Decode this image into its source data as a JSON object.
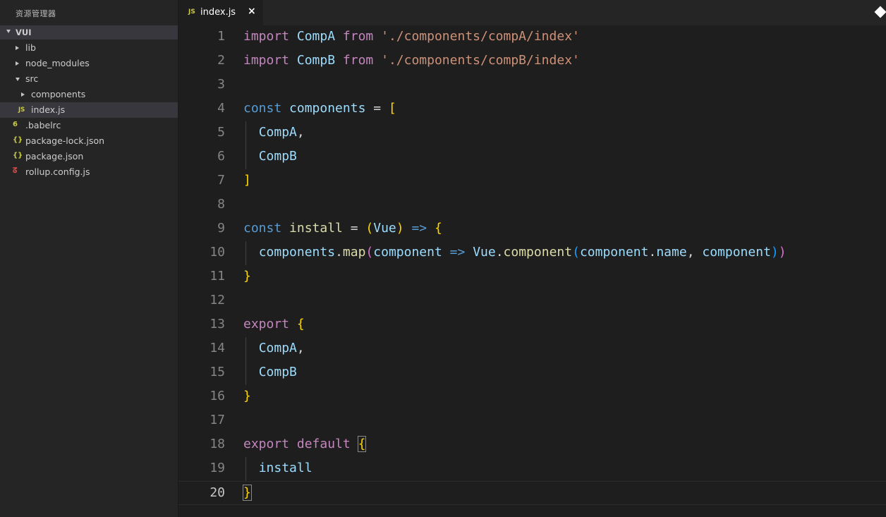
{
  "sidebar": {
    "title": "资源管理器",
    "section": "VUI",
    "items": [
      {
        "label": "lib",
        "type": "folder",
        "expanded": false,
        "depth": 1
      },
      {
        "label": "node_modules",
        "type": "folder",
        "expanded": false,
        "depth": 1
      },
      {
        "label": "src",
        "type": "folder",
        "expanded": true,
        "depth": 1
      },
      {
        "label": "components",
        "type": "folder",
        "expanded": false,
        "depth": 2
      },
      {
        "label": "index.js",
        "type": "js",
        "depth": 2,
        "selected": true
      },
      {
        "label": ".babelrc",
        "type": "babel",
        "depth": 1
      },
      {
        "label": "package-lock.json",
        "type": "json",
        "depth": 1
      },
      {
        "label": "package.json",
        "type": "json",
        "depth": 1
      },
      {
        "label": "rollup.config.js",
        "type": "rollup",
        "depth": 1
      }
    ]
  },
  "icons": {
    "js": "JS",
    "json": "{}",
    "babel": "6",
    "rollup": "ᘔ"
  },
  "tabs": [
    {
      "label": "index.js",
      "icon": "JS",
      "close": "×"
    }
  ],
  "editor": {
    "active_line": 20,
    "lines": [
      {
        "n": "1",
        "tokens": [
          [
            "import",
            "tk-keyword"
          ],
          [
            " ",
            "tk-plain"
          ],
          [
            "CompA",
            "tk-var"
          ],
          [
            " ",
            "tk-plain"
          ],
          [
            "from",
            "tk-keyword"
          ],
          [
            " ",
            "tk-plain"
          ],
          [
            "'./components/compA/index'",
            "tk-str"
          ]
        ]
      },
      {
        "n": "2",
        "tokens": [
          [
            "import",
            "tk-keyword"
          ],
          [
            " ",
            "tk-plain"
          ],
          [
            "CompB",
            "tk-var"
          ],
          [
            " ",
            "tk-plain"
          ],
          [
            "from",
            "tk-keyword"
          ],
          [
            " ",
            "tk-plain"
          ],
          [
            "'./components/compB/index'",
            "tk-str"
          ]
        ]
      },
      {
        "n": "3",
        "tokens": []
      },
      {
        "n": "4",
        "tokens": [
          [
            "const",
            "tk-kw2"
          ],
          [
            " ",
            "tk-plain"
          ],
          [
            "components",
            "tk-var"
          ],
          [
            " = ",
            "tk-op"
          ],
          [
            "[",
            "tk-brace"
          ]
        ]
      },
      {
        "n": "5",
        "tokens": [
          [
            "  ",
            "tk-plain"
          ],
          [
            "CompA",
            "tk-var"
          ],
          [
            ",",
            "tk-plain"
          ]
        ]
      },
      {
        "n": "6",
        "tokens": [
          [
            "  ",
            "tk-plain"
          ],
          [
            "CompB",
            "tk-var"
          ]
        ]
      },
      {
        "n": "7",
        "tokens": [
          [
            "]",
            "tk-brace"
          ]
        ]
      },
      {
        "n": "8",
        "tokens": []
      },
      {
        "n": "9",
        "tokens": [
          [
            "const",
            "tk-kw2"
          ],
          [
            " ",
            "tk-plain"
          ],
          [
            "install",
            "tk-func"
          ],
          [
            " = ",
            "tk-op"
          ],
          [
            "(",
            "tk-brace"
          ],
          [
            "Vue",
            "tk-var"
          ],
          [
            ")",
            "tk-brace"
          ],
          [
            " ",
            "tk-plain"
          ],
          [
            "=>",
            "tk-kw2"
          ],
          [
            " ",
            "tk-plain"
          ],
          [
            "{",
            "tk-brace"
          ]
        ]
      },
      {
        "n": "10",
        "tokens": [
          [
            "  ",
            "tk-plain"
          ],
          [
            "components",
            "tk-var"
          ],
          [
            ".",
            "tk-plain"
          ],
          [
            "map",
            "tk-func"
          ],
          [
            "(",
            "tk-paren2"
          ],
          [
            "component",
            "tk-var"
          ],
          [
            " ",
            "tk-plain"
          ],
          [
            "=>",
            "tk-kw2"
          ],
          [
            " ",
            "tk-plain"
          ],
          [
            "Vue",
            "tk-var"
          ],
          [
            ".",
            "tk-plain"
          ],
          [
            "component",
            "tk-func"
          ],
          [
            "(",
            "tk-paren3"
          ],
          [
            "component",
            "tk-var"
          ],
          [
            ".",
            "tk-plain"
          ],
          [
            "name",
            "tk-var"
          ],
          [
            ", ",
            "tk-plain"
          ],
          [
            "component",
            "tk-var"
          ],
          [
            ")",
            "tk-paren3"
          ],
          [
            ")",
            "tk-paren2"
          ]
        ]
      },
      {
        "n": "11",
        "tokens": [
          [
            "}",
            "tk-brace"
          ]
        ]
      },
      {
        "n": "12",
        "tokens": []
      },
      {
        "n": "13",
        "tokens": [
          [
            "export",
            "tk-keyword"
          ],
          [
            " ",
            "tk-plain"
          ],
          [
            "{",
            "tk-brace"
          ]
        ]
      },
      {
        "n": "14",
        "tokens": [
          [
            "  ",
            "tk-plain"
          ],
          [
            "CompA",
            "tk-var"
          ],
          [
            ",",
            "tk-plain"
          ]
        ]
      },
      {
        "n": "15",
        "tokens": [
          [
            "  ",
            "tk-plain"
          ],
          [
            "CompB",
            "tk-var"
          ]
        ]
      },
      {
        "n": "16",
        "tokens": [
          [
            "}",
            "tk-brace"
          ]
        ]
      },
      {
        "n": "17",
        "tokens": []
      },
      {
        "n": "18",
        "tokens": [
          [
            "export",
            "tk-keyword"
          ],
          [
            " ",
            "tk-plain"
          ],
          [
            "default",
            "tk-keyword"
          ],
          [
            " ",
            "tk-plain"
          ],
          [
            "{",
            "tk-brace match"
          ]
        ]
      },
      {
        "n": "19",
        "tokens": [
          [
            "  ",
            "tk-plain"
          ],
          [
            "install",
            "tk-var"
          ]
        ]
      },
      {
        "n": "20",
        "tokens": [
          [
            "}",
            "tk-brace match"
          ]
        ]
      }
    ],
    "colors": {
      "keyword": "#c586c0",
      "storage": "#569cd6",
      "variable": "#9cdcfe",
      "string": "#ce9178",
      "bracket": "#ffd700"
    }
  }
}
